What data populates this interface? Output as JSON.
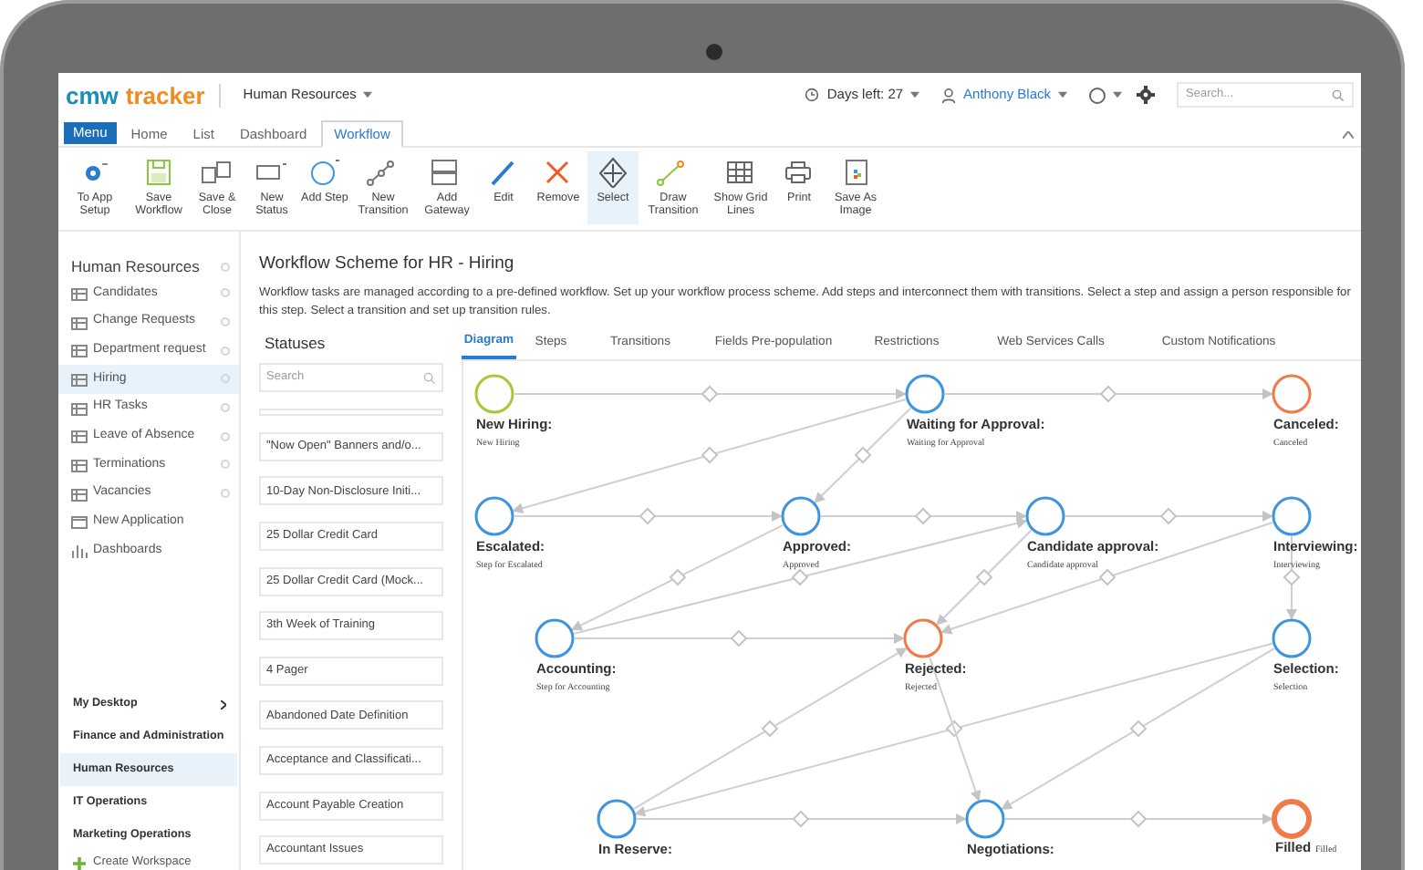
{
  "header": {
    "logo_left": "cmw",
    "logo_right": "tracker",
    "workspace": "Human Resources",
    "days_left": "Days left: 27",
    "user": "Anthony Black",
    "search": {
      "placeholder": "Search..."
    }
  },
  "menu_button": "Menu",
  "menu_tabs": [
    {
      "label": "Home",
      "selected": false
    },
    {
      "label": "List",
      "selected": false
    },
    {
      "label": "Dashboard",
      "selected": false
    },
    {
      "label": "Workflow",
      "selected": true
    }
  ],
  "toolbar": [
    {
      "label": "To App Setup",
      "selected": false
    },
    {
      "label": "Save Workflow",
      "selected": false
    },
    {
      "label": "Save & Close",
      "selected": false
    },
    {
      "label": "New Status",
      "selected": false
    },
    {
      "label": "Add Step",
      "selected": false
    },
    {
      "label": "New Transition",
      "selected": false
    },
    {
      "label": "Add Gateway",
      "selected": false
    },
    {
      "label": "Edit",
      "selected": false
    },
    {
      "label": "Remove",
      "selected": false
    },
    {
      "label": "Select",
      "selected": true
    },
    {
      "label": "Draw Transition",
      "selected": false
    },
    {
      "label": "Show Grid Lines",
      "selected": false
    },
    {
      "label": "Print",
      "selected": false
    },
    {
      "label": "Save As Image",
      "selected": false
    }
  ],
  "sidebar": {
    "title": "Human Resources",
    "items": [
      {
        "label": "Candidates",
        "kind": "app",
        "selected": false
      },
      {
        "label": "Change Requests",
        "kind": "app",
        "selected": false
      },
      {
        "label": "Department request",
        "kind": "app",
        "selected": false
      },
      {
        "label": "Hiring",
        "kind": "app",
        "selected": true
      },
      {
        "label": "HR Tasks",
        "kind": "app",
        "selected": false
      },
      {
        "label": "Leave of Absence",
        "kind": "app",
        "selected": false
      },
      {
        "label": "Terminations",
        "kind": "app",
        "selected": false
      },
      {
        "label": "Vacancies",
        "kind": "app",
        "selected": false
      },
      {
        "label": "New Application",
        "kind": "new",
        "selected": false
      },
      {
        "label": "Dashboards",
        "kind": "dashboards",
        "selected": false
      }
    ]
  },
  "workspaces": [
    {
      "label": "My Desktop",
      "expandable": true,
      "selected": false
    },
    {
      "label": "Finance and Administration",
      "expandable": false,
      "selected": false
    },
    {
      "label": "Human Resources",
      "expandable": false,
      "selected": true
    },
    {
      "label": "IT Operations",
      "expandable": false,
      "selected": false
    },
    {
      "label": "Marketing Operations",
      "expandable": false,
      "selected": false
    }
  ],
  "create_workspace": "Create Workspace",
  "page": {
    "title": "Workflow Scheme for HR - Hiring",
    "description": "Workflow tasks are managed according to a pre-defined workflow. Set up your workflow process scheme. Add steps and interconnect them with transitions. Select a step and assign a person responsible for this step. Select a transition and set up transition rules."
  },
  "statuses": {
    "title": "Statuses",
    "search": {
      "placeholder": "Search"
    },
    "items": [
      "\"Now Open\" Banners and/o...",
      "10-Day Non-Disclosure Initi...",
      "25 Dollar Credit Card",
      "25 Dollar Credit Card (Mock...",
      "3th Week of Training",
      "4 Pager",
      "Abandoned Date Definition",
      "Acceptance and Classificati...",
      "Account Payable Creation",
      "Accountant Issues"
    ]
  },
  "diagram_tabs": [
    {
      "label": "Diagram",
      "selected": true
    },
    {
      "label": "Steps",
      "selected": false
    },
    {
      "label": "Transitions",
      "selected": false
    },
    {
      "label": "Fields Pre-population",
      "selected": false
    },
    {
      "label": "Restrictions",
      "selected": false
    },
    {
      "label": "Web Services Calls",
      "selected": false
    },
    {
      "label": "Custom Notifications",
      "selected": false
    }
  ],
  "steps": [
    {
      "name": "New Hiring:",
      "caption": "New Hiring",
      "kind": "step",
      "color": "#a5c93a"
    },
    {
      "name": "Waiting for Approval:",
      "caption": "Waiting for Approval",
      "kind": "step",
      "color": "#3d95e0"
    },
    {
      "name": "Canceled:",
      "caption": "Canceled",
      "kind": "step",
      "color": "#f07b4a"
    },
    {
      "name": "Escalated:",
      "caption": "Step for Escalated",
      "kind": "step",
      "color": "#3d95e0"
    },
    {
      "name": "Approved:",
      "caption": "Approved",
      "kind": "step",
      "color": "#3d95e0"
    },
    {
      "name": "Candidate approval:",
      "caption": "Candidate approval",
      "kind": "step",
      "color": "#3d95e0"
    },
    {
      "name": "Interviewing:",
      "caption": "Interviewing",
      "kind": "step",
      "color": "#3d95e0"
    },
    {
      "name": "Accounting:",
      "caption": "Step for Accounting",
      "kind": "step",
      "color": "#3d95e0"
    },
    {
      "name": "Rejected:",
      "caption": "Rejected",
      "kind": "step",
      "color": "#f07b4a"
    },
    {
      "name": "Selection:",
      "caption": "Selection",
      "kind": "step",
      "color": "#3d95e0"
    },
    {
      "name": "In Reserve:",
      "kind": "step",
      "color": "#3d95e0"
    },
    {
      "name": "Negotiations:",
      "kind": "step",
      "color": "#3d95e0"
    },
    {
      "name": "Filled",
      "caption": "Filled",
      "kind": "final",
      "color": "#f07b4a"
    }
  ]
}
